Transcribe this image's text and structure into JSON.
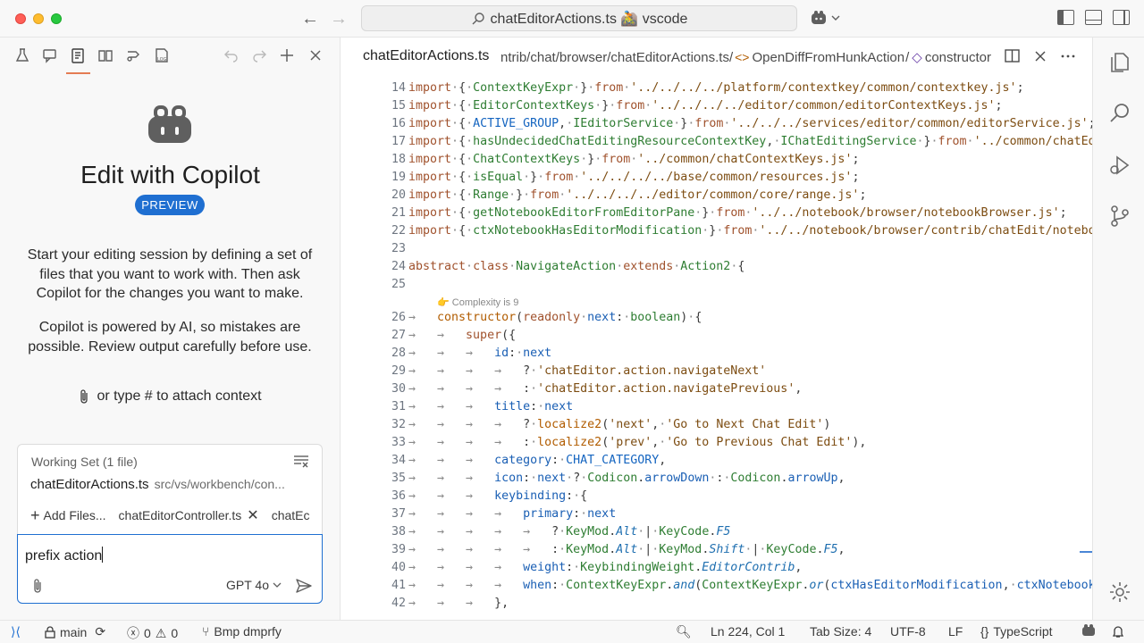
{
  "window": {
    "command_center_text": "chatEditorActions.ts 🚵 vscode"
  },
  "left_panel": {
    "hero_title": "Edit with Copilot",
    "preview_badge": "PREVIEW",
    "description_1": "Start your editing session by defining a set of files that you want to work with. Then ask Copilot for the changes you want to make.",
    "description_2": "Copilot is powered by AI, so mistakes are possible. Review output carefully before use.",
    "attach_hint": "or type # to attach context",
    "working_set": {
      "header": "Working Set (1 file)",
      "file_name": "chatEditorActions.ts",
      "file_path": "src/vs/workbench/con...",
      "add_files_label": "Add Files...",
      "chips": [
        "chatEditorController.ts",
        "chatEc"
      ]
    },
    "chat_input": {
      "value": "prefix action",
      "model": "GPT 4o"
    }
  },
  "editor": {
    "tab_file": "chatEditorActions.ts",
    "breadcrumb_path": "ntrib/chat/browser/chatEditorActions.ts/",
    "breadcrumb_symbol_1": "OpenDiffFromHunkAction",
    "breadcrumb_symbol_2": "constructor",
    "codelens": "👉 Complexity is 9",
    "line_numbers": [
      "14",
      "15",
      "16",
      "17",
      "18",
      "19",
      "20",
      "21",
      "22",
      "23",
      "24",
      "25",
      "26",
      "27",
      "28",
      "29",
      "30",
      "31",
      "32",
      "33",
      "34",
      "35",
      "36",
      "37",
      "38",
      "39",
      "40",
      "41",
      "42"
    ]
  },
  "status_bar": {
    "branch": "main",
    "errors": "0",
    "warnings": "0",
    "extension": "Bmp dmprfy",
    "cursor": "Ln 224, Col 1",
    "tab_size": "Tab Size: 4",
    "encoding": "UTF-8",
    "eol": "LF",
    "language": "TypeScript"
  },
  "colors": {
    "accent": "#1f6fd1",
    "active_tab_underline": "#e47c53"
  }
}
